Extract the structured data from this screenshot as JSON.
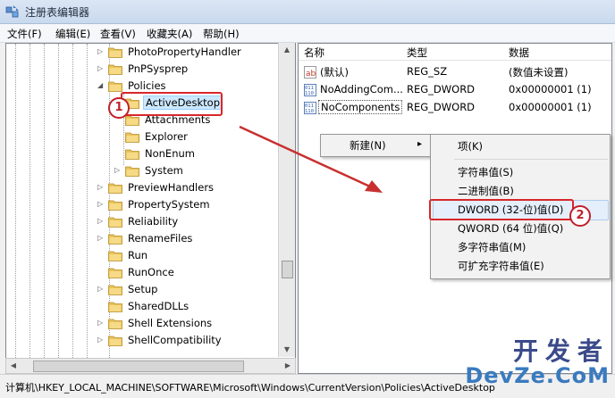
{
  "window": {
    "title": "注册表编辑器"
  },
  "menu": [
    "文件(F)",
    "编辑(E)",
    "查看(V)",
    "收藏夹(A)",
    "帮助(H)"
  ],
  "tree": {
    "items": [
      {
        "label": "PhotoPropertyHandler",
        "expander": "▷",
        "depth": 0
      },
      {
        "label": "PnPSysprep",
        "expander": "▷",
        "depth": 0
      },
      {
        "label": "Policies",
        "expander": "◢",
        "depth": 0
      },
      {
        "label": "ActiveDesktop",
        "expander": "",
        "depth": 1,
        "selected": true
      },
      {
        "label": "Attachments",
        "expander": "",
        "depth": 1
      },
      {
        "label": "Explorer",
        "expander": "",
        "depth": 1
      },
      {
        "label": "NonEnum",
        "expander": "",
        "depth": 1
      },
      {
        "label": "System",
        "expander": "▷",
        "depth": 1
      },
      {
        "label": "PreviewHandlers",
        "expander": "▷",
        "depth": 0
      },
      {
        "label": "PropertySystem",
        "expander": "▷",
        "depth": 0
      },
      {
        "label": "Reliability",
        "expander": "▷",
        "depth": 0
      },
      {
        "label": "RenameFiles",
        "expander": "▷",
        "depth": 0
      },
      {
        "label": "Run",
        "expander": "",
        "depth": 0
      },
      {
        "label": "RunOnce",
        "expander": "",
        "depth": 0
      },
      {
        "label": "Setup",
        "expander": "▷",
        "depth": 0
      },
      {
        "label": "SharedDLLs",
        "expander": "",
        "depth": 0
      },
      {
        "label": "Shell Extensions",
        "expander": "▷",
        "depth": 0
      },
      {
        "label": "ShellCompatibility",
        "expander": "▷",
        "depth": 0
      }
    ]
  },
  "annotations": {
    "step1": "1",
    "step2": "2"
  },
  "values": {
    "headers": {
      "name": "名称",
      "type": "类型",
      "data": "数据"
    },
    "rows": [
      {
        "name": "(默认)",
        "type": "REG_SZ",
        "data": "(数值未设置)",
        "icon": "string-value-icon"
      },
      {
        "name": "NoAddingCom...",
        "type": "REG_DWORD",
        "data": "0x00000001 (1)",
        "icon": "binary-value-icon"
      },
      {
        "name": "NoComponents",
        "type": "REG_DWORD",
        "data": "0x00000001 (1)",
        "icon": "binary-value-icon"
      }
    ]
  },
  "context_menu": {
    "new_label": "新建(N)",
    "arrow": "▸"
  },
  "submenu": {
    "key": "项(K)",
    "items": [
      "字符串值(S)",
      "二进制值(B)",
      "DWORD (32-位)值(D)",
      "QWORD (64 位)值(Q)",
      "多字符串值(M)",
      "可扩充字符串值(E)"
    ],
    "highlighted_index": 2
  },
  "statusbar": {
    "path": "计算机\\HKEY_LOCAL_MACHINE\\SOFTWARE\\Microsoft\\Windows\\CurrentVersion\\Policies\\ActiveDesktop"
  },
  "watermark": {
    "line1": "开发者",
    "line2": "DevZe.CoM"
  },
  "colors": {
    "accent_red": "#d8272b",
    "selection": "#cde8ff",
    "folder": "#e8c35a"
  }
}
